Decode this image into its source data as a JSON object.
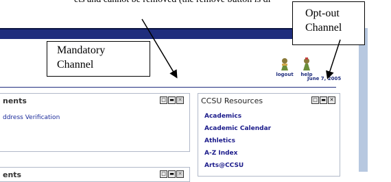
{
  "caption_top": "ets and cannot be removed (the remove button is di",
  "callouts": {
    "mandatory": [
      "Mandatory",
      "Channel"
    ],
    "optout": [
      "Opt-out",
      "Channel"
    ]
  },
  "header": {
    "logout_label": "logout",
    "help_label": "help",
    "date": "June 7, 2005"
  },
  "channel1": {
    "title": "nents",
    "link": "ddress Verification",
    "controls": [
      "□",
      "▬",
      "✕"
    ]
  },
  "channel2": {
    "title": "ents",
    "controls": [
      "□",
      "▬",
      "✕"
    ]
  },
  "resources": {
    "title": "CCSU Resources",
    "controls": [
      "□",
      "▬",
      "✕"
    ],
    "links": [
      "Academics",
      "Academic Calendar",
      "Athletics",
      "A-Z Index",
      "Arts@CCSU"
    ]
  },
  "colors": {
    "topbar": "#1f2d7d",
    "link": "#1a2a9a",
    "sidebar": "#b7c8e0"
  }
}
